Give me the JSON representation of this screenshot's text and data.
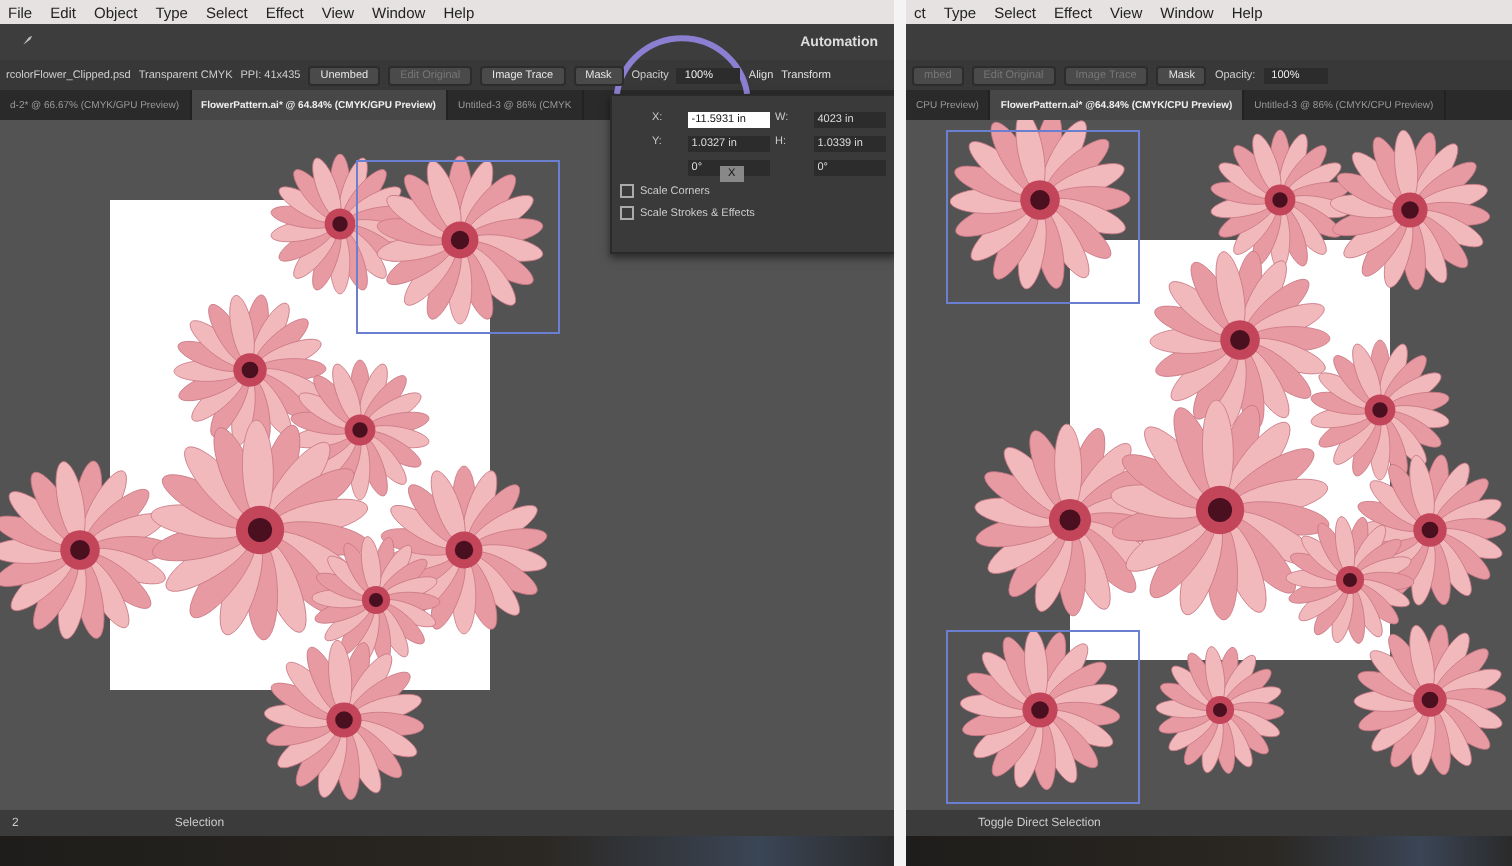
{
  "panels": [
    {
      "menu": [
        "File",
        "Edit",
        "Object",
        "Type",
        "Select",
        "Effect",
        "View",
        "Window",
        "Help"
      ],
      "workspace": "Automation",
      "control_bar": [
        {
          "kind": "label",
          "text": "rcolorFlower_Clipped.psd"
        },
        {
          "kind": "label",
          "text": "Transparent CMYK"
        },
        {
          "kind": "label",
          "text": "PPI: 41x435"
        },
        {
          "kind": "button",
          "text": "Unembed",
          "disabled": false
        },
        {
          "kind": "button",
          "text": "Edit Original",
          "disabled": true
        },
        {
          "kind": "button",
          "text": "Image Trace",
          "disabled": false
        },
        {
          "kind": "button",
          "text": "Mask",
          "disabled": false
        },
        {
          "kind": "label",
          "text": "Opacity"
        },
        {
          "kind": "field",
          "text": "100%"
        },
        {
          "kind": "link",
          "text": "Align"
        },
        {
          "kind": "link",
          "text": "Transform"
        }
      ],
      "tabs": [
        {
          "label": "d-2* @ 66.67% (CMYK/GPU Preview)",
          "selected": false
        },
        {
          "label": "FlowerPattern.ai* @ 64.84% (CMYK/GPU Preview)",
          "selected": true
        },
        {
          "label": "Untitled-3 @ 86% (CMYK",
          "selected": false
        }
      ],
      "transform_popup": {
        "x_label": "X:",
        "x_value": "-11.5931 in",
        "w_label": "W:",
        "w_value": "4023 in",
        "y_label": "Y:",
        "y_value": "1.0327 in",
        "h_label": "H:",
        "h_value": "1.0339 in",
        "tooltip": "X",
        "angle": "0°",
        "shear": "0°",
        "options": [
          {
            "label": "Scale Corners",
            "checked": false
          },
          {
            "label": "Scale Strokes & Effects",
            "checked": false
          }
        ]
      },
      "status": {
        "page": "2",
        "tool": "Selection"
      }
    },
    {
      "menu": [
        "ct",
        "Type",
        "Select",
        "Effect",
        "View",
        "Window",
        "Help"
      ],
      "control_bar": [
        {
          "kind": "button",
          "text": "mbed",
          "disabled": true
        },
        {
          "kind": "button",
          "text": "Edit Original",
          "disabled": true
        },
        {
          "kind": "button",
          "text": "Image Trace",
          "disabled": true
        },
        {
          "kind": "button",
          "text": "Mask",
          "disabled": false
        },
        {
          "kind": "label",
          "text": "Opacity:"
        },
        {
          "kind": "field",
          "text": "100%"
        }
      ],
      "tabs": [
        {
          "label": "CPU Preview)",
          "selected": false
        },
        {
          "label": "FlowerPattern.ai* @64.84% (CMYK/CPU Preview)",
          "selected": true
        },
        {
          "label": "Untitled-3 @ 86% (CMYK/CPU Preview)",
          "selected": false
        }
      ],
      "status": {
        "tool": "Toggle Direct Selection"
      }
    }
  ]
}
